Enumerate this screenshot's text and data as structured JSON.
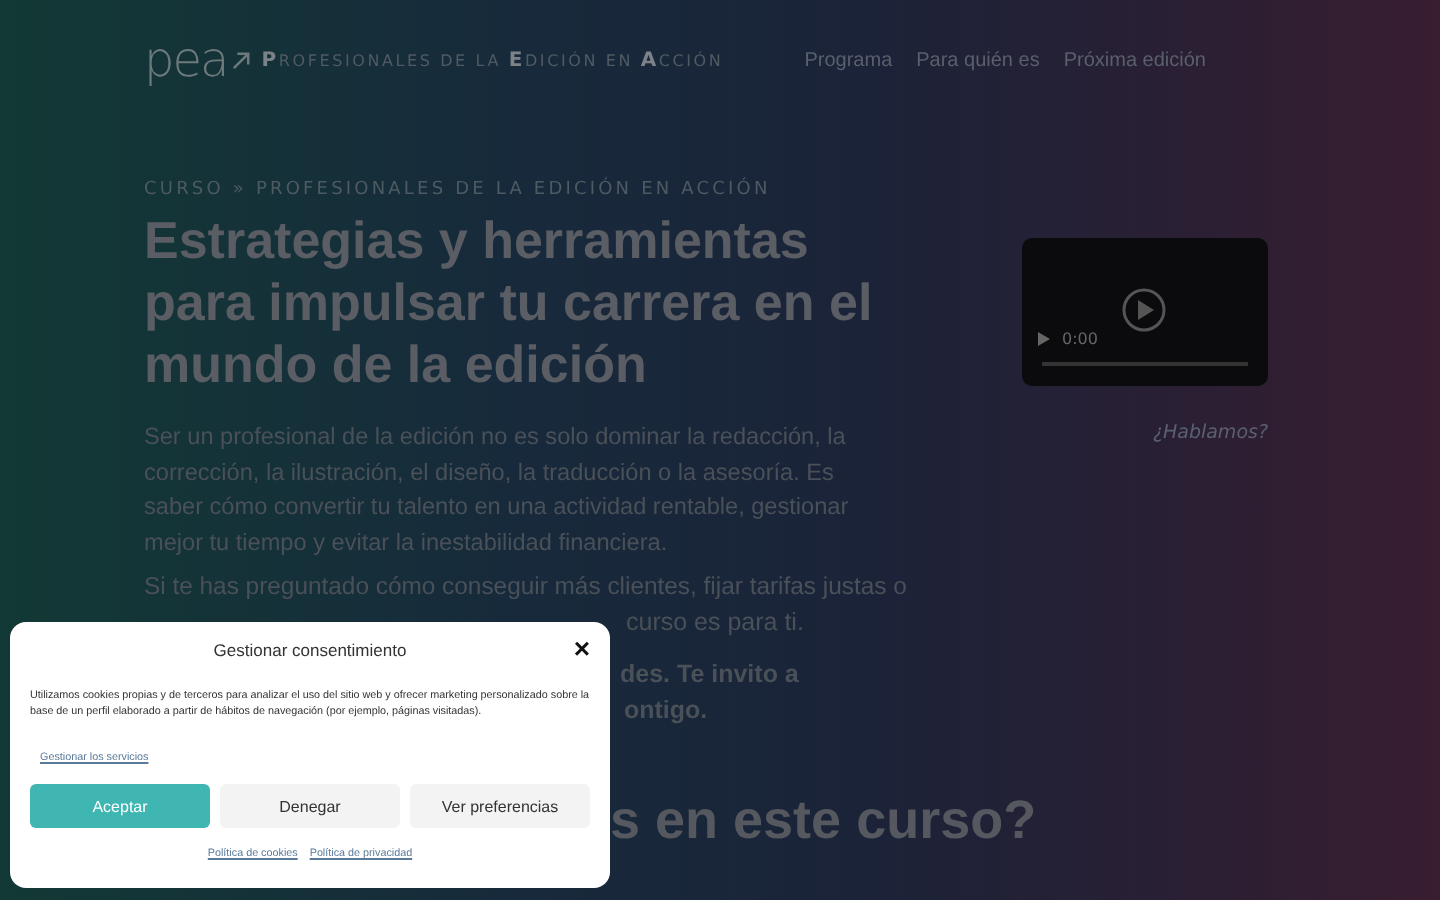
{
  "header": {
    "logo": "pea",
    "tagline": "**P**ROFESIONALES DE LA **E**DICIÓN EN **A**CCIÓN",
    "nav": [
      "Programa",
      "Para quién es",
      "Próxima edición"
    ]
  },
  "hero": {
    "breadcrumb": "CURSO » PROFESIONALES DE LA EDICIÓN EN ACCIÓN",
    "title": "Estrategias y herramientas para impulsar tu carrera en el mundo de la edición",
    "paragraph": "Ser un profesional de la edición no es solo dominar la redacción, la corrección, la ilustración, el diseño, la traducción o la asesoría. Es saber cómo convertir tu talento en una actividad rentable, gestionar mejor tu tiempo y evitar la inestabilidad financiera.",
    "partial_texts": [
      {
        "text": "Si te has preguntado cómo conseguir más clientes, fijar tarifas justas o",
        "bold": false
      },
      {
        "text": "curso es para ti.",
        "bold": false
      },
      {
        "text": "des. Te invito a",
        "bold": true
      },
      {
        "text": "ontigo.",
        "bold": true
      }
    ],
    "video": {
      "time": "0:00"
    },
    "contact_link": "¿Hablamos?",
    "section_heading": "s en este curso?"
  },
  "cookie_dialog": {
    "title": "Gestionar consentimiento",
    "close": "×",
    "body": "Utilizamos cookies propias y de terceros para analizar el uso del sitio web y ofrecer marketing personalizado sobre la base de un perfil elaborado a partir de hábitos de navegación (por ejemplo, páginas visitadas).",
    "manage_link": "Gestionar los servicios",
    "buttons": [
      {
        "label": "Aceptar",
        "kind": "primary"
      },
      {
        "label": "Denegar",
        "kind": "secondary"
      },
      {
        "label": "Ver preferencias",
        "kind": "secondary"
      }
    ],
    "footer_links": [
      "Política de cookies",
      "Política de privacidad"
    ]
  }
}
